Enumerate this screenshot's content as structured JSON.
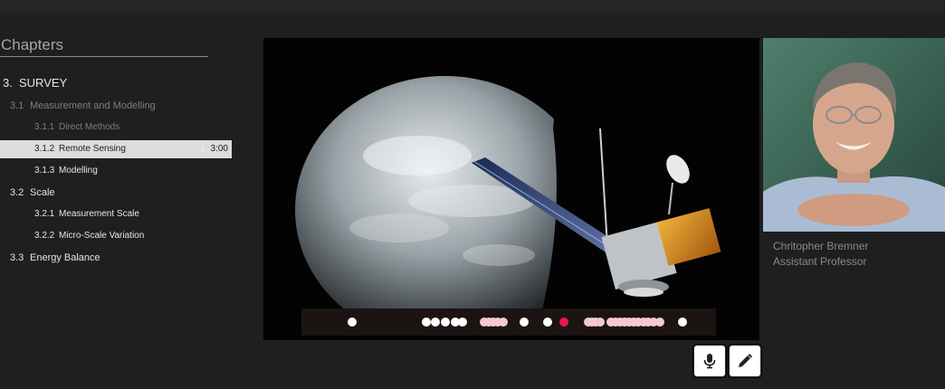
{
  "sidebar": {
    "title": "Chapters",
    "items": [
      {
        "num": "3.",
        "label": "SURVEY"
      },
      {
        "num": "3.1",
        "label": "Measurement and Modelling"
      },
      {
        "num": "3.1.1",
        "label": "Direct Methods"
      },
      {
        "num": "3.1.2",
        "label": "Remote Sensing",
        "duration": "3:00"
      },
      {
        "num": "3.1.3",
        "label": "Modelling"
      },
      {
        "num": "3.2",
        "label": "Scale"
      },
      {
        "num": "3.2.1",
        "label": "Measurement Scale"
      },
      {
        "num": "3.2.2",
        "label": "Micro-Scale Variation"
      },
      {
        "num": "3.3",
        "label": "Energy Balance"
      }
    ]
  },
  "video": {
    "description_icon": "satellite-earth-scene",
    "timeline_markers": 29,
    "current_marker_index": 13
  },
  "presenter": {
    "name": "Chritopher Bremner",
    "role": "Assistant Professor"
  },
  "toolbar": {
    "mic_icon": "microphone-icon",
    "edit_icon": "pencil-icon"
  },
  "colors": {
    "background": "#1f1f1f",
    "active_row": "#dcdcdc",
    "current_marker": "#e8194c"
  }
}
